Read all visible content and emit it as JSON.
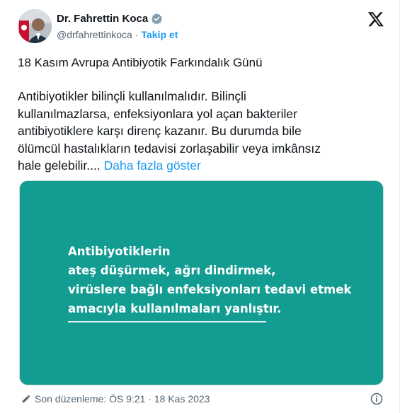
{
  "author": {
    "name": "Dr. Fahrettin Koca",
    "handle": "@drfahrettinkoca",
    "separator": "·",
    "follow_label": "Takip et"
  },
  "tweet": {
    "title": "18 Kasım Avrupa Antibiyotik Farkındalık Günü",
    "body_lines": [
      "Antibiyotikler bilinçli kullanılmalıdır. Bilinçli",
      "kullanılmazlarsa, enfeksiyonlara yol açan bakteriler",
      "antibiyotiklere karşı direnç kazanır. Bu durumda bile",
      "ölümcül hastalıkların tedavisi zorlaşabilir veya imkânsız",
      "hale gelebilir...."
    ],
    "show_more": "Daha fazla göster"
  },
  "media": {
    "background_color": "#139c92",
    "lines": [
      "Antibiyotiklerin",
      "ateş düşürmek, ağrı dindirmek,",
      "virüslere bağlı enfeksiyonları tedavi etmek",
      "amacıyla kullanılmaları yanlıştır."
    ]
  },
  "footer": {
    "edited_label": "Son düzenleme: ÖS 9:21 · 18 Kas 2023"
  },
  "icons": [
    "verified-badge-icon",
    "x-logo-icon",
    "pencil-icon",
    "info-icon"
  ],
  "colors": {
    "accent": "#1d9bf0",
    "secondary_text": "#536471"
  }
}
